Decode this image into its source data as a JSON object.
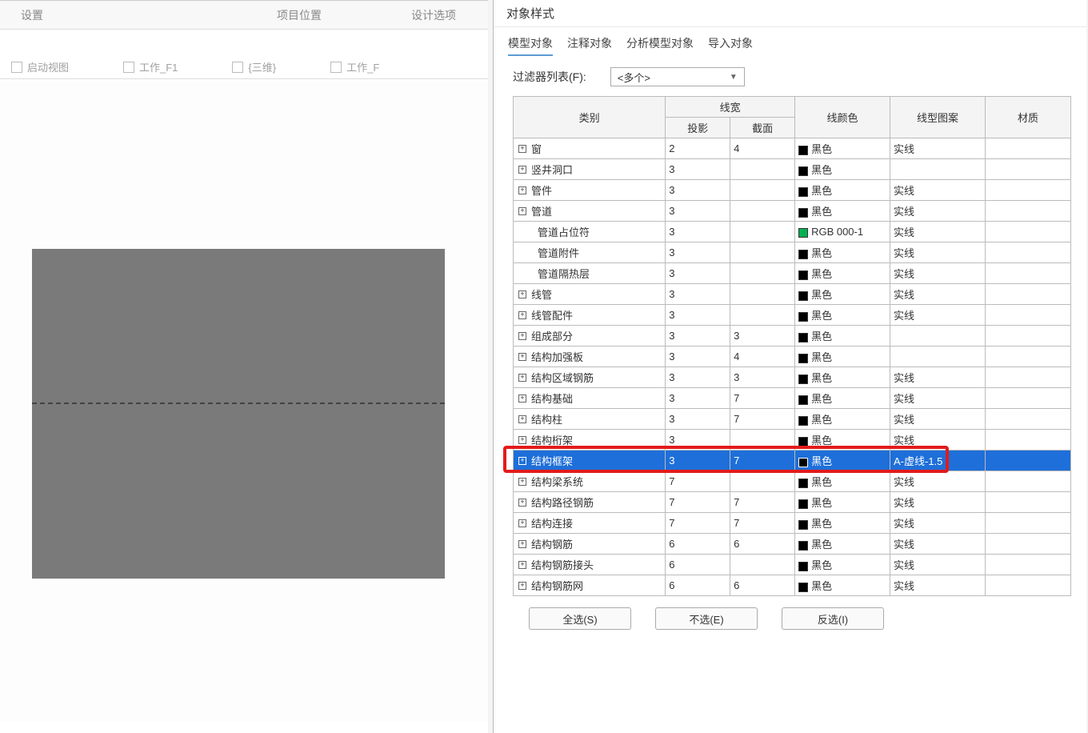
{
  "ribbon": {
    "tab1": "设置",
    "tab2": "项目位置",
    "tab3": "设计选项"
  },
  "docTabs": {
    "t1": "启动视图",
    "t2": "工作_F1",
    "t3": "{三维}",
    "t4": "工作_F"
  },
  "dialog": {
    "title": "对象样式",
    "tabs": {
      "t1": "模型对象",
      "t2": "注释对象",
      "t3": "分析模型对象",
      "t4": "导入对象"
    },
    "filterLabel": "过滤器列表(F):",
    "filterValue": "<多个>",
    "headers": {
      "category": "类别",
      "lineweight": "线宽",
      "projection": "投影",
      "section": "截面",
      "linecolor": "线颜色",
      "pattern": "线型图案",
      "material": "材质"
    },
    "rows": [
      {
        "name": "窗",
        "exp": true,
        "indent": 0,
        "proj": "2",
        "sect": "4",
        "sectHatch": false,
        "swatch": "black",
        "color": "黑色",
        "pattern": "实线"
      },
      {
        "name": "竖井洞口",
        "exp": true,
        "indent": 0,
        "proj": "3",
        "sect": "",
        "sectHatch": true,
        "swatch": "black",
        "color": "黑色",
        "pattern": ""
      },
      {
        "name": "管件",
        "exp": true,
        "indent": 0,
        "proj": "3",
        "sect": "",
        "sectHatch": true,
        "swatch": "black",
        "color": "黑色",
        "pattern": "实线"
      },
      {
        "name": "管道",
        "exp": true,
        "indent": 0,
        "proj": "3",
        "sect": "",
        "sectHatch": true,
        "swatch": "black",
        "color": "黑色",
        "pattern": "实线"
      },
      {
        "name": "管道占位符",
        "exp": false,
        "indent": 1,
        "proj": "3",
        "sect": "",
        "sectHatch": true,
        "swatch": "green",
        "color": "RGB 000-1",
        "pattern": "实线"
      },
      {
        "name": "管道附件",
        "exp": false,
        "indent": 1,
        "proj": "3",
        "sect": "",
        "sectHatch": true,
        "swatch": "black",
        "color": "黑色",
        "pattern": "实线"
      },
      {
        "name": "管道隔热层",
        "exp": false,
        "indent": 1,
        "proj": "3",
        "sect": "",
        "sectHatch": true,
        "swatch": "black",
        "color": "黑色",
        "pattern": "实线"
      },
      {
        "name": "线管",
        "exp": true,
        "indent": 0,
        "proj": "3",
        "sect": "",
        "sectHatch": true,
        "swatch": "black",
        "color": "黑色",
        "pattern": "实线"
      },
      {
        "name": "线管配件",
        "exp": true,
        "indent": 0,
        "proj": "3",
        "sect": "",
        "sectHatch": true,
        "swatch": "black",
        "color": "黑色",
        "pattern": "实线"
      },
      {
        "name": "组成部分",
        "exp": true,
        "indent": 0,
        "proj": "3",
        "sect": "3",
        "sectHatch": false,
        "swatch": "black",
        "color": "黑色",
        "pattern": ""
      },
      {
        "name": "结构加强板",
        "exp": true,
        "indent": 0,
        "proj": "3",
        "sect": "4",
        "sectHatch": false,
        "swatch": "black",
        "color": "黑色",
        "pattern": ""
      },
      {
        "name": "结构区域钢筋",
        "exp": true,
        "indent": 0,
        "proj": "3",
        "sect": "3",
        "sectHatch": false,
        "swatch": "black",
        "color": "黑色",
        "pattern": "实线"
      },
      {
        "name": "结构基础",
        "exp": true,
        "indent": 0,
        "proj": "3",
        "sect": "7",
        "sectHatch": false,
        "swatch": "black",
        "color": "黑色",
        "pattern": "实线"
      },
      {
        "name": "结构柱",
        "exp": true,
        "indent": 0,
        "proj": "3",
        "sect": "7",
        "sectHatch": false,
        "swatch": "black",
        "color": "黑色",
        "pattern": "实线"
      },
      {
        "name": "结构桁架",
        "exp": true,
        "indent": 0,
        "proj": "3",
        "sect": "",
        "sectHatch": true,
        "swatch": "black",
        "color": "黑色",
        "pattern": "实线"
      },
      {
        "name": "结构框架",
        "exp": true,
        "indent": 0,
        "proj": "3",
        "sect": "7",
        "sectHatch": false,
        "swatch": "black",
        "color": "黑色",
        "pattern": "A-虚线-1.5",
        "selected": true
      },
      {
        "name": "结构梁系统",
        "exp": true,
        "indent": 0,
        "proj": "7",
        "sect": "",
        "sectHatch": true,
        "swatch": "black",
        "color": "黑色",
        "pattern": "实线"
      },
      {
        "name": "结构路径钢筋",
        "exp": true,
        "indent": 0,
        "proj": "7",
        "sect": "7",
        "sectHatch": false,
        "swatch": "black",
        "color": "黑色",
        "pattern": "实线"
      },
      {
        "name": "结构连接",
        "exp": true,
        "indent": 0,
        "proj": "7",
        "sect": "7",
        "sectHatch": false,
        "swatch": "black",
        "color": "黑色",
        "pattern": "实线"
      },
      {
        "name": "结构钢筋",
        "exp": true,
        "indent": 0,
        "proj": "6",
        "sect": "6",
        "sectHatch": false,
        "swatch": "black",
        "color": "黑色",
        "pattern": "实线"
      },
      {
        "name": "结构钢筋接头",
        "exp": true,
        "indent": 0,
        "proj": "6",
        "sect": "",
        "sectHatch": true,
        "swatch": "black",
        "color": "黑色",
        "pattern": "实线"
      },
      {
        "name": "结构钢筋网",
        "exp": true,
        "indent": 0,
        "proj": "6",
        "sect": "6",
        "sectHatch": false,
        "swatch": "black",
        "color": "黑色",
        "pattern": "实线"
      }
    ],
    "buttons": {
      "selectAll": "全选(S)",
      "selectNone": "不选(E)",
      "invert": "反选(I)"
    }
  }
}
